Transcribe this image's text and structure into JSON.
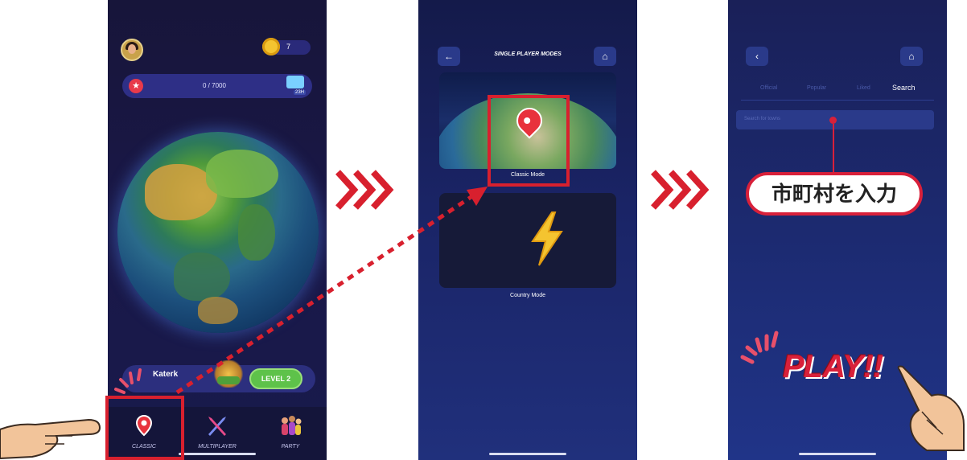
{
  "screen1": {
    "coin_count": "7",
    "xp_text": "0 / 7000",
    "gift_label": "23H",
    "level_name": "Katerk",
    "level_button": "LEVEL 2",
    "tabs": [
      {
        "label": "CLASSIC",
        "icon": "map-pin-icon"
      },
      {
        "label": "MULTIPLAYER",
        "icon": "crossed-swords-icon"
      },
      {
        "label": "PARTY",
        "icon": "party-people-icon"
      }
    ]
  },
  "screen2": {
    "title": "SINGLE PLAYER MODES",
    "back_icon": "back-arrow-icon",
    "home_icon": "home-icon",
    "modes": [
      {
        "label": "Classic Mode",
        "icon": "map-pin-icon"
      },
      {
        "label": "Country Mode",
        "icon": "lightning-bolt-icon"
      }
    ]
  },
  "screen3": {
    "back_icon": "back-arrow-icon",
    "home_icon": "home-icon",
    "tabs": [
      "Official",
      "Popular",
      "Liked",
      "Search"
    ],
    "active_tab": "Search",
    "search_placeholder": "Search for towns",
    "callout": "市町村を入力",
    "play_text": "PLAY!!"
  },
  "annotations": {
    "highlight_color": "#d8202e",
    "arrow_color": "#d8202e"
  }
}
